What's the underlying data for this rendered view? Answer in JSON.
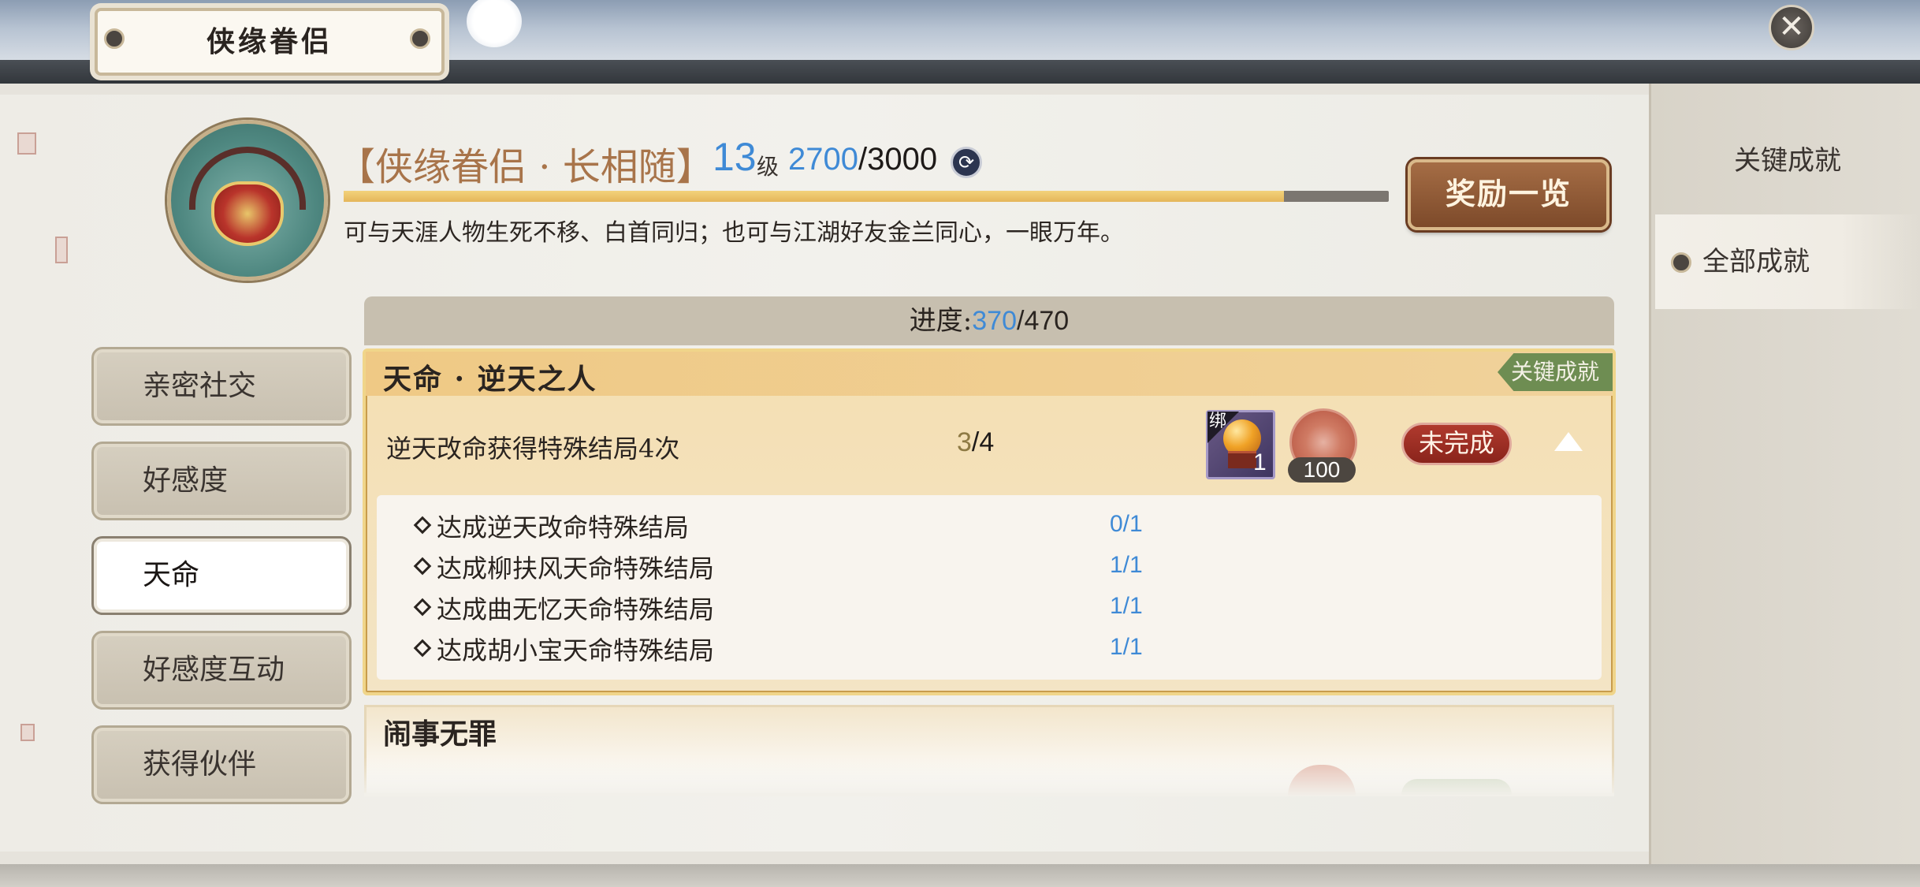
{
  "window": {
    "title": "侠缘眷侣",
    "close_icon": "close-icon"
  },
  "achievement": {
    "title": "【侠缘眷侣 · 长相随】",
    "level": "13",
    "level_unit": "级",
    "exp_current": "2700",
    "exp_total": "/3000",
    "exp_progress": 0.9,
    "exp_icon": "exp-coin-icon",
    "description": "可与天涯人物生死不移、白首同归；也可与江湖好友金兰同心，一眼万年。",
    "reward_button": "奖励一览"
  },
  "right_tabs": [
    {
      "label": "关键成就",
      "active": false
    },
    {
      "label": "全部成就",
      "active": true
    }
  ],
  "categories": [
    {
      "label": "亲密社交",
      "active": false
    },
    {
      "label": "好感度",
      "active": false
    },
    {
      "label": "天命",
      "active": true
    },
    {
      "label": "好感度互动",
      "active": false
    },
    {
      "label": "获得伙伴",
      "active": false
    }
  ],
  "progress": {
    "label": "进度:",
    "current": "370",
    "total": "/470"
  },
  "cards": [
    {
      "title": "天命 · 逆天之人",
      "badge": "关键成就",
      "task": "逆天改命获得特殊结局4次",
      "task_current": "3",
      "task_total": "/4",
      "reward_item_bind": "绑",
      "reward_item_count": "1",
      "reward_coin_count": "100",
      "status": "未完成",
      "expanded": true,
      "sub_tasks": [
        {
          "label": "达成逆天改命特殊结局",
          "progress": "0/1"
        },
        {
          "label": "达成柳扶风天命特殊结局",
          "progress": "1/1"
        },
        {
          "label": "达成曲无忆天命特殊结局",
          "progress": "1/1"
        },
        {
          "label": "达成胡小宝天命特殊结局",
          "progress": "1/1"
        }
      ]
    },
    {
      "title": "闹事无罪"
    }
  ],
  "colors": {
    "accent_blue": "#3f8ad6",
    "title_brown": "#a8744a",
    "badge_green": "#6e8d52",
    "status_red": "#9a2e24"
  }
}
